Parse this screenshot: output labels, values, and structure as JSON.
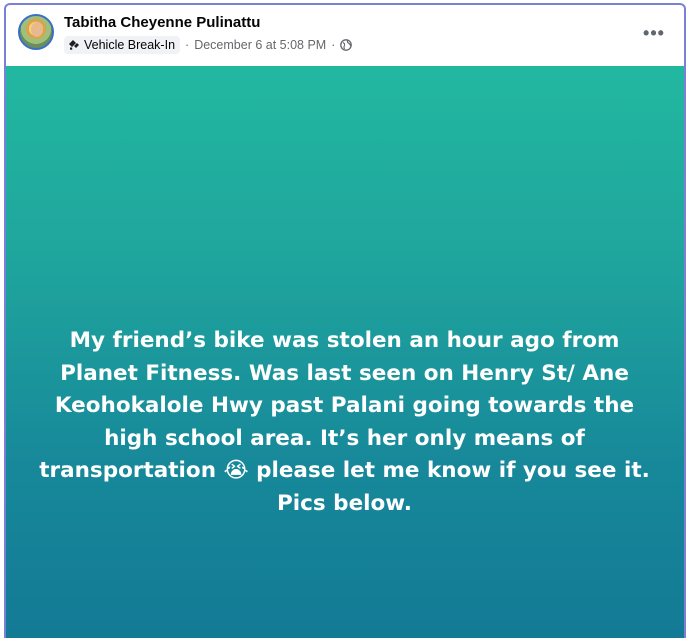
{
  "post": {
    "author": "Tabitha Cheyenne Pulinattu",
    "tag_label": "Vehicle Break-In",
    "timestamp": "December 6 at 5:08 PM",
    "separator": "·",
    "more_label": "•••",
    "text": "My friend’s bike was stolen an hour ago from Planet Fitness. Was last seen on Henry St/ Ane Keohokalole Hwy past Palani going towards the high school area. It’s her only means of transportation 😭 please let me know if you see it. Pics below.",
    "background_colors": [
      "#22b8a0",
      "#137a95"
    ]
  },
  "icons": {
    "tag": "neighborhood-tag-icon",
    "privacy": "globe-icon",
    "more": "more-options-icon"
  }
}
